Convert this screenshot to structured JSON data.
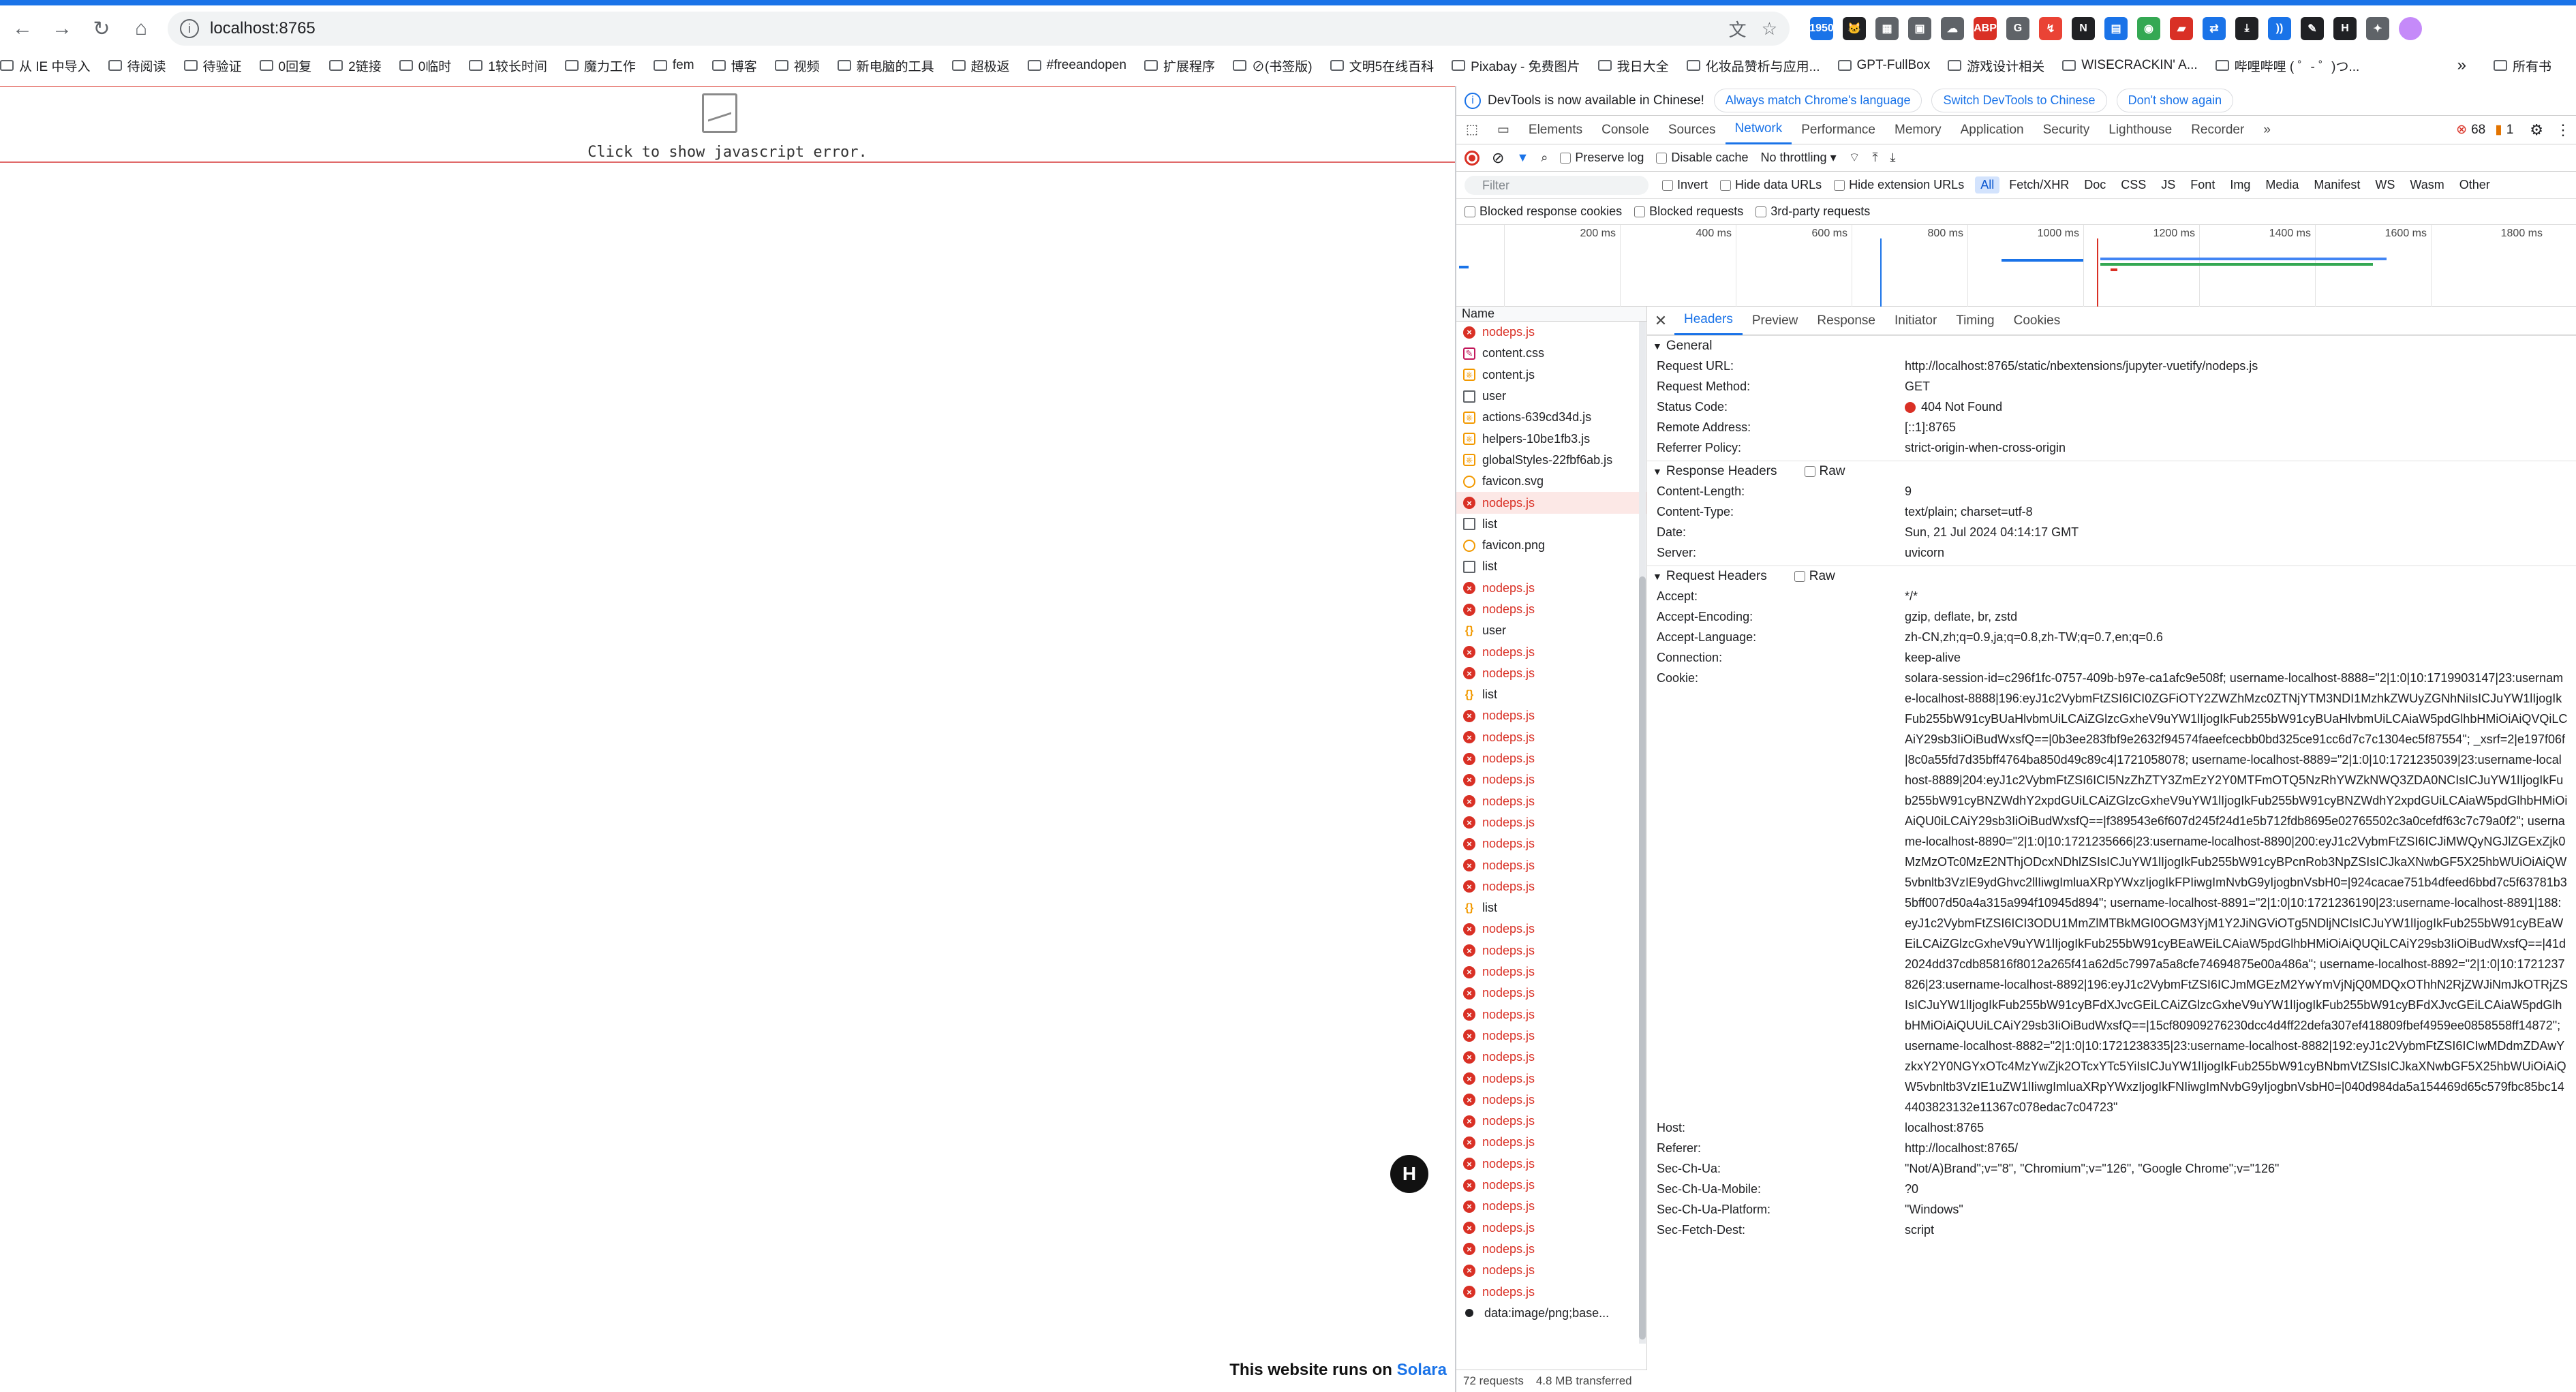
{
  "browser": {
    "url": "localhost:8765",
    "extensions": [
      {
        "name": "ext-1950",
        "label": "1950",
        "color": "#1a73e8"
      },
      {
        "name": "ext-cat",
        "label": "🐱",
        "color": "#202124"
      },
      {
        "name": "ext-tiles",
        "label": "▦",
        "color": "#5f6368"
      },
      {
        "name": "ext-img",
        "label": "▣",
        "color": "#5f6368"
      },
      {
        "name": "ext-cloud",
        "label": "☁",
        "color": "#5f6368"
      },
      {
        "name": "ext-abp",
        "label": "ABP",
        "color": "#d93025"
      },
      {
        "name": "ext-g",
        "label": "G",
        "color": "#5f6368"
      },
      {
        "name": "ext-red",
        "label": "↯",
        "color": "#ea4335"
      },
      {
        "name": "ext-notion",
        "label": "N",
        "color": "#202124"
      },
      {
        "name": "ext-blue",
        "label": "▤",
        "color": "#1a73e8"
      },
      {
        "name": "ext-green",
        "label": "◉",
        "color": "#34a853"
      },
      {
        "name": "ext-rec",
        "label": "▰",
        "color": "#d93025"
      },
      {
        "name": "ext-tr",
        "label": "⇄",
        "color": "#1a73e8"
      },
      {
        "name": "ext-dl",
        "label": "⤓",
        "color": "#202124"
      },
      {
        "name": "ext-wave",
        "label": "))",
        "color": "#1a73e8"
      },
      {
        "name": "ext-pen",
        "label": "✎",
        "color": "#202124"
      },
      {
        "name": "ext-h",
        "label": "H",
        "color": "#202124"
      },
      {
        "name": "ext-puzzle",
        "label": "✦",
        "color": "#5f6368"
      }
    ],
    "bookmarks": [
      "从 IE 中导入",
      "待阅读",
      "待验证",
      "0回复",
      "2链接",
      "0临时",
      "1较长时间",
      "魔力工作",
      "fem",
      "博客",
      "视频",
      "新电脑的工具",
      "超极返",
      "#freeandopen",
      "扩展程序",
      "⊘(书签版)",
      "文明5在线百科",
      "Pixabay - 免费图片",
      "我日大全",
      "化妆品赞析与应用...",
      "GPT-FullBox",
      "游戏设计相关",
      "WISECRACKIN' A...",
      "哔哩哔哩 ( ゜- ゜)つ..."
    ],
    "bookmarks_overflow": "»",
    "bookmarks_all": "所有书"
  },
  "page": {
    "error_text": "Click to show javascript error.",
    "footer_prefix": "This website runs on ",
    "footer_brand": "Solara",
    "solara_badge": "H"
  },
  "devtools": {
    "banner": {
      "text": "DevTools is now available in Chinese!",
      "btn_match": "Always match Chrome's language",
      "btn_switch": "Switch DevTools to Chinese",
      "btn_dismiss": "Don't show again"
    },
    "tabs": [
      "Elements",
      "Console",
      "Sources",
      "Network",
      "Performance",
      "Memory",
      "Application",
      "Security",
      "Lighthouse",
      "Recorder"
    ],
    "active_tab": "Network",
    "more_tabs": "»",
    "error_count": "68",
    "warn_count": "1",
    "toolbar": {
      "preserve_log": "Preserve log",
      "disable_cache": "Disable cache",
      "throttling": "No throttling"
    },
    "filter": {
      "placeholder": "Filter",
      "invert": "Invert",
      "hide_data_urls": "Hide data URLs",
      "hide_extension_urls": "Hide extension URLs",
      "types": [
        "All",
        "Fetch/XHR",
        "Doc",
        "CSS",
        "JS",
        "Font",
        "Img",
        "Media",
        "Manifest",
        "WS",
        "Wasm",
        "Other"
      ],
      "blocked_cookies": "Blocked response cookies",
      "blocked_requests": "Blocked requests",
      "third_party": "3rd-party requests"
    },
    "timeline_ticks": [
      "200 ms",
      "400 ms",
      "600 ms",
      "800 ms",
      "1000 ms",
      "1200 ms",
      "1400 ms",
      "1600 ms",
      "1800 ms"
    ],
    "name_header": "Name",
    "requests": [
      {
        "name": "nodeps.js",
        "type": "err"
      },
      {
        "name": "content.css",
        "type": "css"
      },
      {
        "name": "content.js",
        "type": "js"
      },
      {
        "name": "user",
        "type": "doc"
      },
      {
        "name": "actions-639cd34d.js",
        "type": "js"
      },
      {
        "name": "helpers-10be1fb3.js",
        "type": "js"
      },
      {
        "name": "globalStyles-22fbf6ab.js",
        "type": "js"
      },
      {
        "name": "favicon.svg",
        "type": "svg"
      },
      {
        "name": "nodeps.js",
        "type": "err",
        "selected": true
      },
      {
        "name": "list",
        "type": "doc"
      },
      {
        "name": "favicon.png",
        "type": "svg"
      },
      {
        "name": "list",
        "type": "doc"
      },
      {
        "name": "nodeps.js",
        "type": "err"
      },
      {
        "name": "nodeps.js",
        "type": "err"
      },
      {
        "name": "user",
        "type": "api"
      },
      {
        "name": "nodeps.js",
        "type": "err"
      },
      {
        "name": "nodeps.js",
        "type": "err"
      },
      {
        "name": "list",
        "type": "api"
      },
      {
        "name": "nodeps.js",
        "type": "err"
      },
      {
        "name": "nodeps.js",
        "type": "err"
      },
      {
        "name": "nodeps.js",
        "type": "err"
      },
      {
        "name": "nodeps.js",
        "type": "err"
      },
      {
        "name": "nodeps.js",
        "type": "err"
      },
      {
        "name": "nodeps.js",
        "type": "err"
      },
      {
        "name": "nodeps.js",
        "type": "err"
      },
      {
        "name": "nodeps.js",
        "type": "err"
      },
      {
        "name": "nodeps.js",
        "type": "err"
      },
      {
        "name": "list",
        "type": "api"
      },
      {
        "name": "nodeps.js",
        "type": "err"
      },
      {
        "name": "nodeps.js",
        "type": "err"
      },
      {
        "name": "nodeps.js",
        "type": "err"
      },
      {
        "name": "nodeps.js",
        "type": "err"
      },
      {
        "name": "nodeps.js",
        "type": "err"
      },
      {
        "name": "nodeps.js",
        "type": "err"
      },
      {
        "name": "nodeps.js",
        "type": "err"
      },
      {
        "name": "nodeps.js",
        "type": "err"
      },
      {
        "name": "nodeps.js",
        "type": "err"
      },
      {
        "name": "nodeps.js",
        "type": "err"
      },
      {
        "name": "nodeps.js",
        "type": "err"
      },
      {
        "name": "nodeps.js",
        "type": "err"
      },
      {
        "name": "nodeps.js",
        "type": "err"
      },
      {
        "name": "nodeps.js",
        "type": "err"
      },
      {
        "name": "nodeps.js",
        "type": "err"
      },
      {
        "name": "nodeps.js",
        "type": "err"
      },
      {
        "name": "nodeps.js",
        "type": "err"
      },
      {
        "name": "nodeps.js",
        "type": "err"
      },
      {
        "name": "data:image/png;base...",
        "type": "img"
      }
    ],
    "status": {
      "requests": "72 requests",
      "transferred": "4.8 MB transferred"
    },
    "detail_tabs": [
      "Headers",
      "Preview",
      "Response",
      "Initiator",
      "Timing",
      "Cookies"
    ],
    "general": {
      "title": "General",
      "rows": [
        {
          "k": "Request URL:",
          "v": "http://localhost:8765/static/nbextensions/jupyter-vuetify/nodeps.js"
        },
        {
          "k": "Request Method:",
          "v": "GET"
        },
        {
          "k": "Status Code:",
          "v": "404 Not Found"
        },
        {
          "k": "Remote Address:",
          "v": "[::1]:8765"
        },
        {
          "k": "Referrer Policy:",
          "v": "strict-origin-when-cross-origin"
        }
      ]
    },
    "response_headers": {
      "title": "Response Headers",
      "raw": "Raw",
      "rows": [
        {
          "k": "Content-Length:",
          "v": "9"
        },
        {
          "k": "Content-Type:",
          "v": "text/plain; charset=utf-8"
        },
        {
          "k": "Date:",
          "v": "Sun, 21 Jul 2024 04:14:17 GMT"
        },
        {
          "k": "Server:",
          "v": "uvicorn"
        }
      ]
    },
    "request_headers": {
      "title": "Request Headers",
      "raw": "Raw",
      "rows": [
        {
          "k": "Accept:",
          "v": "*/*"
        },
        {
          "k": "Accept-Encoding:",
          "v": "gzip, deflate, br, zstd"
        },
        {
          "k": "Accept-Language:",
          "v": "zh-CN,zh;q=0.9,ja;q=0.8,zh-TW;q=0.7,en;q=0.6"
        },
        {
          "k": "Connection:",
          "v": "keep-alive"
        }
      ],
      "cookie_key": "Cookie:",
      "cookie_value": "solara-session-id=c296f1fc-0757-409b-b97e-ca1afc9e508f; username-localhost-8888=\"2|1:0|10:1719903147|23:username-localhost-8888|196:eyJ1c2VybmFtZSI6ICI0ZGFiOTY2ZWZhMzc0ZTNjYTM3NDI1MzhkZWUyZGNhNiIsICJuYW1lIjogIkFub255bW91cyBUaHlvbmUiLCAiZGlzcGxheV9uYW1lIjogIkFub255bW91cyBUaHlvbmUiLCAiaW5pdGlhbHMiOiAiQVQiLCAiY29sb3IiOiBudWxsfQ==|0b3ee283fbf9e2632f94574faeefcecbb0bd325ce91cc6d7c7c1304ec5f87554\"; _xsrf=2|e197f06f|8c0a55fd7d35bff4764ba850d49c89c4|1721058078; username-localhost-8889=\"2|1:0|10:1721235039|23:username-localhost-8889|204:eyJ1c2VybmFtZSI6ICI5NzZhZTY3ZmEzY2Y0MTFmOTQ5NzRhYWZkNWQ3ZDA0NCIsICJuYW1lIjogIkFub255bW91cyBNZWdhY2xpdGUiLCAiZGlzcGxheV9uYW1lIjogIkFub255bW91cyBNZWdhY2xpdGUiLCAiaW5pdGlhbHMiOiAiQU0iLCAiY29sb3IiOiBudWxsfQ==|f389543e6f607d245f24d1e5b712fdb8695e02765502c3a0cefdf63c7c79a0f2\"; username-localhost-8890=\"2|1:0|10:1721235666|23:username-localhost-8890|200:eyJ1c2VybmFtZSI6ICJiMWQyNGJlZGExZjk0MzMzOTc0MzE2NThjODcxNDhlZSIsICJuYW1lIjogIkFub255bW91cyBPcnRob3NpZSIsICJkaXNwbGF5X25hbWUiOiAiQW5vbnltb3VzIE9ydGhvc2llIiwgImluaXRpYWxzIjogIkFPIiwgImNvbG9yIjogbnVsbH0=|924cacae751b4dfeed6bbd7c5f63781b35bff007d50a4a315a994f10945d894\"; username-localhost-8891=\"2|1:0|10:1721236190|23:username-localhost-8891|188:eyJ1c2VybmFtZSI6ICI3ODU1MmZlMTBkMGI0OGM3YjM1Y2JiNGViOTg5NDljNCIsICJuYW1lIjogIkFub255bW91cyBEaWEiLCAiZGlzcGxheV9uYW1lIjogIkFub255bW91cyBEaWEiLCAiaW5pdGlhbHMiOiAiQUQiLCAiY29sb3IiOiBudWxsfQ==|41d2024dd37cdb85816f8012a265f41a62d5c7997a5a8cfe74694875e00a486a\"; username-localhost-8892=\"2|1:0|10:1721237826|23:username-localhost-8892|196:eyJ1c2VybmFtZSI6ICJmMGEzM2YwYmVjNjQ0MDQxOThhN2RjZWJiNmJkOTRjZSIsICJuYW1lIjogIkFub255bW91cyBFdXJvcGEiLCAiZGlzcGxheV9uYW1lIjogIkFub255bW91cyBFdXJvcGEiLCAiaW5pdGlhbHMiOiAiQUUiLCAiY29sb3IiOiBudWxsfQ==|15cf80909276230dcc4d4ff22defa307ef418809fbef4959ee0858558ff14872\"; username-localhost-8882=\"2|1:0|10:1721238335|23:username-localhost-8882|192:eyJ1c2VybmFtZSI6ICIwMDdmZDAwYzkxY2Y0NGYxOTc4MzYwZjk2OTcxYTc5YiIsICJuYW1lIjogIkFub255bW91cyBNbmVtZSIsICJkaXNwbGF5X25hbWUiOiAiQW5vbnltb3VzIE1uZW1lIiwgImluaXRpYWxzIjogIkFNIiwgImNvbG9yIjogbnVsbH0=|040d984da5a154469d65c579fbc85bc144403823132e11367c078edac7c04723\"",
      "rows_after": [
        {
          "k": "Host:",
          "v": "localhost:8765"
        },
        {
          "k": "Referer:",
          "v": "http://localhost:8765/"
        },
        {
          "k": "Sec-Ch-Ua:",
          "v": "\"Not/A)Brand\";v=\"8\", \"Chromium\";v=\"126\", \"Google Chrome\";v=\"126\""
        },
        {
          "k": "Sec-Ch-Ua-Mobile:",
          "v": "?0"
        },
        {
          "k": "Sec-Ch-Ua-Platform:",
          "v": "\"Windows\""
        },
        {
          "k": "Sec-Fetch-Dest:",
          "v": "script"
        }
      ]
    },
    "colors": {
      "accent": "#1a73e8",
      "error": "#d93025",
      "selected_row": "#fce8e6"
    }
  }
}
